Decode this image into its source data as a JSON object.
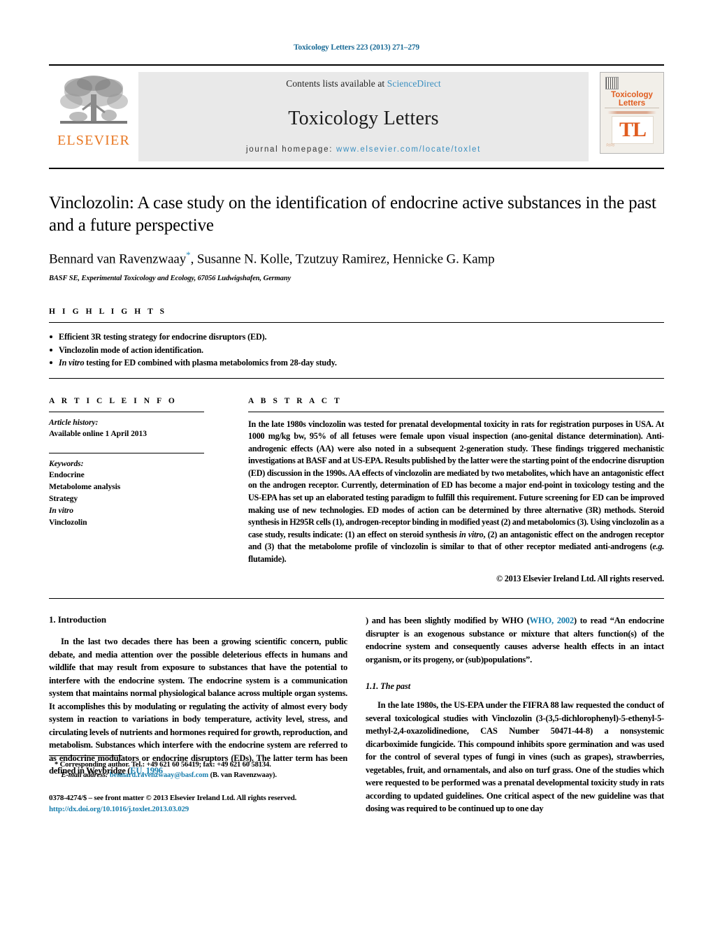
{
  "running_head": "Toxicology Letters 223 (2013) 271–279",
  "masthead": {
    "publisher_word": "ELSEVIER",
    "contents_prefix": "Contents lists available at ",
    "contents_link": "ScienceDirect",
    "journal_name": "Toxicology Letters",
    "homepage_prefix": "journal homepage: ",
    "homepage_url": "www.elsevier.com/locate/toxlet",
    "cover": {
      "title_line1": "Toxicology",
      "title_line2": "Letters",
      "logo": "TL"
    }
  },
  "article": {
    "title": "Vinclozolin: A case study on the identification of endocrine active substances in the past and a future perspective",
    "authors": "Bennard van Ravenzwaay",
    "authors_rest": ", Susanne N. Kolle, Tzutzuy Ramirez, Hennicke G. Kamp",
    "corresponding_marker": "*",
    "affiliation": "BASF SE, Experimental Toxicology and Ecology, 67056 Ludwigshafen, Germany"
  },
  "highlights": {
    "label": "H I G H L I G H T S",
    "items": [
      {
        "pre": "",
        "ital": "",
        "post": "Efficient 3R testing strategy for endocrine disruptors (ED)."
      },
      {
        "pre": "",
        "ital": "",
        "post": "Vinclozolin mode of action identification."
      },
      {
        "pre": "",
        "ital": "In vitro",
        "post": " testing for ED combined with plasma metabolomics from 28-day study."
      }
    ]
  },
  "article_info": {
    "label": "A R T I C L E    I N F O",
    "history_label": "Article history:",
    "history_value": "Available online 1 April 2013",
    "keywords_label": "Keywords:",
    "keywords": [
      "Endocrine",
      "Metabolome analysis",
      "Strategy",
      "In vitro",
      "Vinclozolin"
    ],
    "keywords_italic_index": 3
  },
  "abstract": {
    "label": "A B S T R A C T",
    "text_part1": "In the late 1980s vinclozolin was tested for prenatal developmental toxicity in rats for registration purposes in USA. At 1000 mg/kg bw, 95% of all fetuses were female upon visual inspection (ano-genital distance determination). Anti-androgenic effects (AA) were also noted in a subsequent 2-generation study. These findings triggered mechanistic investigations at BASF and at US-EPA. Results published by the latter were the starting point of the endocrine disruption (ED) discussion in the 1990s. AA effects of vinclozolin are mediated by two metabolites, which have an antagonistic effect on the androgen receptor. Currently, determination of ED has become a major end-point in toxicology testing and the US-EPA has set up an elaborated testing paradigm to fulfill this requirement. Future screening for ED can be improved making use of new technologies. ED modes of action can be determined by three alternative (3R) methods. Steroid synthesis in H295R cells (1), androgen-receptor binding in modified yeast (2) and metabolomics (3). Using vinclozolin as a case study, results indicate: (1) an effect on steroid synthesis ",
    "italic1": "in vitro",
    "text_part2": ", (2) an antagonistic effect on the androgen receptor and (3) that the metabolome profile of vinclozolin is similar to that of other receptor mediated anti-androgens (",
    "italic2": "e.g.",
    "text_part3": " flutamide).",
    "copyright": "© 2013 Elsevier Ireland Ltd. All rights reserved."
  },
  "body": {
    "section1_heading": "1.  Introduction",
    "para1_a": "In the last two decades there has been a growing scientific concern, public debate, and media attention over the possible deleterious effects in humans and wildlife that may result from exposure to substances that have the potential to interfere with the endocrine system. The endocrine system is a communication system that maintains normal physiological balance across multiple organ systems. It accomplishes this by modulating or regulating the activity of almost every body system in reaction to variations in body temperature, activity level, stress, and circulating levels of nutrients and hormones required for growth, reproduction, and metabolism. Substances which interfere with the endocrine system are referred to as endocrine modulators or endocrine disruptors (EDs). The latter term has been defined in Weybridge (",
    "para1_link1": "EU, 1996",
    "para1_b": ") and has been slightly modified by WHO (",
    "para1_link2": "WHO, 2002",
    "para1_c": ") to read “An endocrine disrupter is an exogenous substance or mixture that alters function(s) of the endocrine system and consequently causes adverse health effects in an intact organism, or its progeny, or (sub)populations”.",
    "section11_heading": "1.1.  The past",
    "para2": "In the late 1980s, the US-EPA under the FIFRA 88 law requested the conduct of several toxicological studies with Vinclozolin (3-(3,5-dichlorophenyl)-5-ethenyl-5-methyl-2,4-oxazolidinedione, CAS Number 50471-44-8) a nonsystemic dicarboximide fungicide. This compound inhibits spore germination and was used for the control of several types of fungi in vines (such as grapes), strawberries, vegetables, fruit, and ornamentals, and also on turf grass. One of the studies which were requested to be performed was a prenatal developmental toxicity study in rats according to updated guidelines. One critical aspect of the new guideline was that dosing was required to be continued up to one day"
  },
  "footnotes": {
    "corresponding_marker": "*",
    "corresponding_text": " Corresponding author. Tel.: +49 621 60 56419; fax: +49 621 60 58134.",
    "email_label": "E-mail address:",
    "email": "bennard.ravenzwaay@basf.com",
    "email_suffix": " (B. van Ravenzwaay).",
    "issn_line": "0378-4274/$ – see front matter © 2013 Elsevier Ireland Ltd. All rights reserved.",
    "doi": "http://dx.doi.org/10.1016/j.toxlet.2013.03.029"
  },
  "colors": {
    "link_blue": "#1a7fae",
    "elsevier_orange": "#E87722",
    "band_gray": "#e9e9e9"
  }
}
